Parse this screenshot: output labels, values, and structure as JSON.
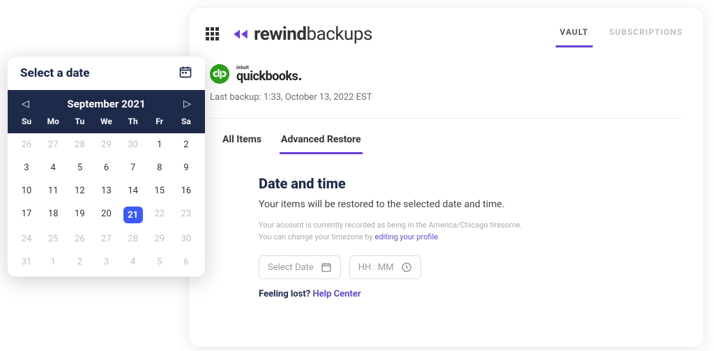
{
  "brand": {
    "rewind": "rewind",
    "backups": "backups"
  },
  "nav": {
    "vault": "VAULT",
    "subscriptions": "SUBSCRIPTIONS",
    "active": "vault"
  },
  "product": {
    "intuit": "intuit",
    "name": "quickbooks"
  },
  "last_backup": "Last backup: 1:33, October 13, 2022 EST",
  "sub_tabs": {
    "all_items": "All Items",
    "advanced_restore": "Advanced Restore",
    "active": "advanced_restore"
  },
  "panel": {
    "heading": "Date and time",
    "lead": "Your items will be restored to the selected date and time.",
    "tz_line1": "Your account is currently recorded as being in the America/Chicago tiresome.",
    "tz_line2_prefix": "You can change your timezone by ",
    "tz_link": "editing your profile",
    "tz_line2_suffix": ".",
    "date_placeholder": "Select Date",
    "time_placeholder": "HH : MM",
    "help_prefix": "Feeling lost? ",
    "help_link": "Help Center"
  },
  "calendar": {
    "title": "Select a date",
    "month_label": "September 2021",
    "dow": [
      "Su",
      "Mo",
      "Tu",
      "We",
      "Th",
      "Fr",
      "Sa"
    ],
    "days": [
      {
        "n": 26,
        "other": true
      },
      {
        "n": 27,
        "other": true
      },
      {
        "n": 28,
        "other": true
      },
      {
        "n": 29,
        "other": true
      },
      {
        "n": 30,
        "other": true
      },
      {
        "n": 1
      },
      {
        "n": 2
      },
      {
        "n": 3
      },
      {
        "n": 4
      },
      {
        "n": 5
      },
      {
        "n": 6
      },
      {
        "n": 7
      },
      {
        "n": 8
      },
      {
        "n": 9
      },
      {
        "n": 10
      },
      {
        "n": 11
      },
      {
        "n": 12
      },
      {
        "n": 13
      },
      {
        "n": 14
      },
      {
        "n": 15
      },
      {
        "n": 16
      },
      {
        "n": 17
      },
      {
        "n": 18
      },
      {
        "n": 19
      },
      {
        "n": 20
      },
      {
        "n": 21,
        "selected": true
      },
      {
        "n": 22,
        "other": true
      },
      {
        "n": 23,
        "other": true
      },
      {
        "n": 24,
        "other": true
      },
      {
        "n": 25,
        "other": true
      },
      {
        "n": 26,
        "other": true
      },
      {
        "n": 27,
        "other": true
      },
      {
        "n": 28,
        "other": true
      },
      {
        "n": 29,
        "other": true
      },
      {
        "n": 30,
        "other": true
      },
      {
        "n": 31,
        "other": true
      },
      {
        "n": 1,
        "other": true
      },
      {
        "n": 2,
        "other": true
      },
      {
        "n": 3,
        "other": true
      },
      {
        "n": 4,
        "other": true
      },
      {
        "n": 5,
        "other": true
      },
      {
        "n": 6,
        "other": true
      }
    ]
  }
}
